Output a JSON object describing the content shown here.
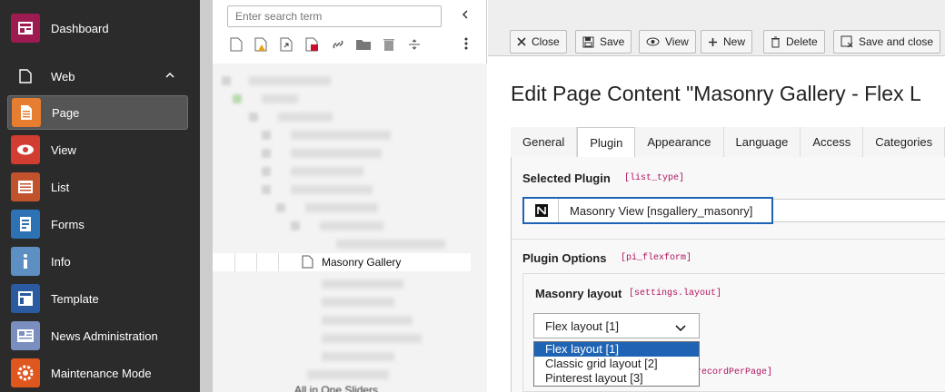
{
  "module_menu": {
    "items": [
      {
        "label": "Dashboard",
        "icon": "dashboard-icon",
        "color": "#9e1b52"
      },
      {
        "label": "Page",
        "icon": "page-icon",
        "color": "#e67d30"
      },
      {
        "label": "View",
        "icon": "eye-icon",
        "color": "#d13d31"
      },
      {
        "label": "List",
        "icon": "list-icon",
        "color": "#c1522c"
      },
      {
        "label": "Forms",
        "icon": "forms-icon",
        "color": "#2e72b6"
      },
      {
        "label": "Info",
        "icon": "info-icon",
        "color": "#5e8fc2"
      },
      {
        "label": "Template",
        "icon": "template-icon",
        "color": "#2a5aa0"
      },
      {
        "label": "News Administration",
        "icon": "news-icon",
        "color": "#7a8fbf"
      },
      {
        "label": "Maintenance Mode",
        "icon": "maintenance-icon",
        "color": "#e0561f"
      }
    ],
    "group_web": "Web"
  },
  "tree": {
    "search_placeholder": "Enter search term",
    "selected_page": "Masonry Gallery",
    "last_visible": "All in One Sliders"
  },
  "toolbar": {
    "close": "Close",
    "save": "Save",
    "view": "View",
    "new": "New",
    "delete": "Delete",
    "save_close": "Save and close"
  },
  "page_title": "Edit Page Content \"Masonry Gallery - Flex L",
  "tabs": [
    "General",
    "Plugin",
    "Appearance",
    "Language",
    "Access",
    "Categories"
  ],
  "active_tab": "Plugin",
  "selected_plugin": {
    "label": "Selected Plugin",
    "key": "[list_type]",
    "value": "Masonry View [nsgallery_masonry]"
  },
  "plugin_options": {
    "label": "Plugin Options",
    "key": "[pi_flexform]"
  },
  "masonry_layout": {
    "label": "Masonry layout",
    "key": "[settings.layout]",
    "selected": "Flex layout [1]",
    "options": [
      "Flex layout [1]",
      "Classic grid layout [2]",
      "Pinterest layout [3]"
    ]
  },
  "behind_key": "recordPerPage]",
  "colors": {
    "accent": "#1e63b4",
    "key_color": "#b0135f",
    "module_bg": "#2b2b2b"
  }
}
